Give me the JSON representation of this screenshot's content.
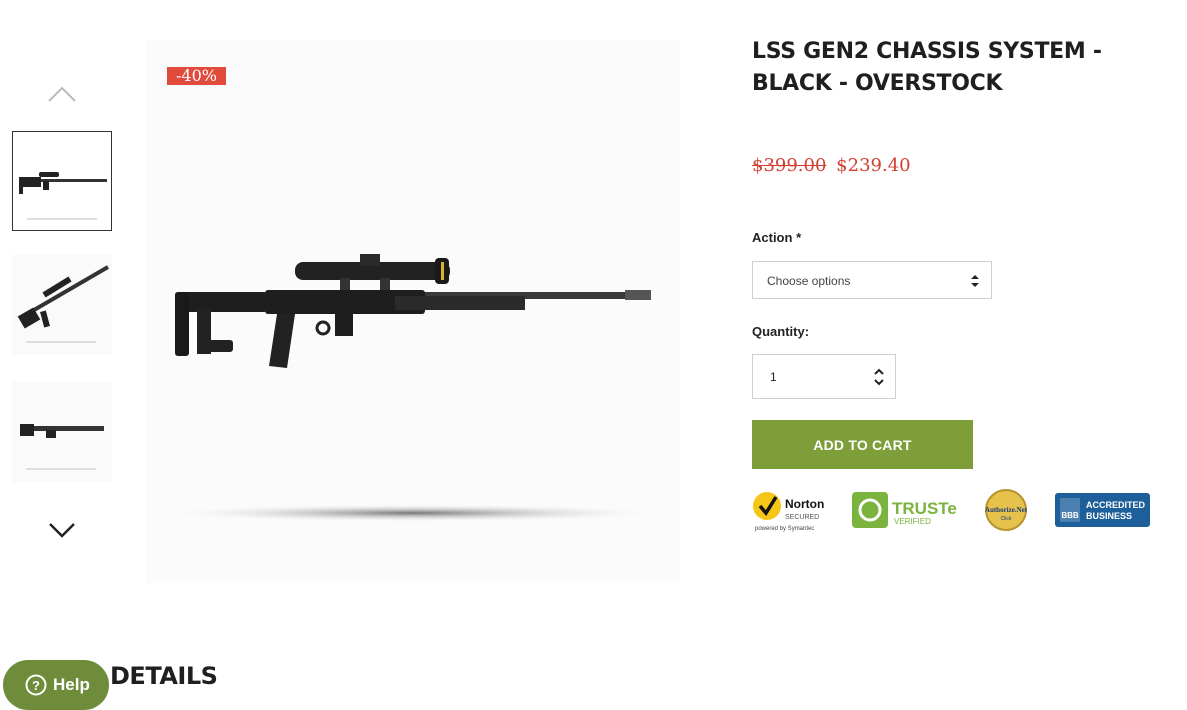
{
  "gallery": {
    "sale_badge": "-40%",
    "thumbnails": [
      {
        "alt": "rifle-with-scope-side"
      },
      {
        "alt": "rifle-with-scope-angled"
      },
      {
        "alt": "chassis-only"
      }
    ]
  },
  "product": {
    "title": "LSS GEN2 CHASSIS SYSTEM - BLACK - OVERSTOCK",
    "price_old": "$399.00",
    "price_new": "$239.40"
  },
  "form": {
    "action_label": "Action",
    "action_required": "*",
    "action_placeholder": "Choose options",
    "quantity_label": "Quantity:",
    "quantity_value": "1",
    "add_to_cart": "ADD TO CART"
  },
  "trust_badges": {
    "norton": {
      "name": "Norton",
      "sub": "SECURED",
      "powered": "powered by Symantec"
    },
    "truste": {
      "name": "TRUSTe",
      "sub": "VERIFIED"
    },
    "authorize": {
      "name": "Authorize.Net",
      "sub": "Click"
    },
    "bbb": {
      "name": "BBB",
      "line1": "ACCREDITED",
      "line2": "BUSINESS"
    }
  },
  "details": {
    "heading": "DETAILS"
  },
  "help": {
    "label": "Help"
  },
  "colors": {
    "sale": "#e04b3b",
    "price": "#d33f32",
    "accent_green": "#7e9e3a",
    "help_green": "#6f8c3a"
  }
}
